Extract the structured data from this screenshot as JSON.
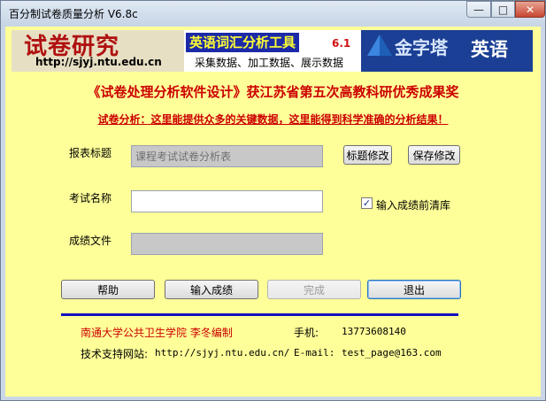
{
  "window": {
    "title": "百分制试卷质量分析 V6.8c",
    "min_glyph": "—",
    "max_glyph": "□",
    "close_glyph": "✕"
  },
  "banner": {
    "logo_title": "试卷研究",
    "logo_url": "http://sjyj.ntu.edu.cn",
    "tool_name": "英语词汇分析工具",
    "tool_version": "6.1",
    "tool_subtitle": "采集数据、加工数据、展示数据",
    "brand_jzt": "金字塔",
    "brand_english": "英语"
  },
  "award": "《试卷处理分析软件设计》获江苏省第五次高教科研优秀成果奖",
  "slogan": "试卷分析：这里能提供众多的关键数据，这里能得到科学准确的分析结果！",
  "form": {
    "report_title_label": "报表标题",
    "report_title_value": "课程考试试卷分析表",
    "btn_edit_title": "标题修改",
    "btn_save_changes": "保存修改",
    "exam_name_label": "考试名称",
    "exam_name_value": "",
    "clear_before_input_label": "输入成绩前清库",
    "clear_before_input_checked": true,
    "scores_file_label": "成绩文件",
    "scores_file_value": ""
  },
  "actions": {
    "help": "帮助",
    "input_scores": "输入成绩",
    "done": "完成",
    "exit": "退出"
  },
  "footer": {
    "author": "南通大学公共卫生学院  李冬编制",
    "phone_label": "手机:",
    "phone_value": "13773608140",
    "site_label": "技术支持网站:",
    "site_url": "http://sjyj.ntu.edu.cn/",
    "email_label": "E-mail:",
    "email_value": "test_page@163.com"
  },
  "colors": {
    "client_bg": "#ffff99",
    "accent_red": "#cc0000",
    "divider_blue": "#1010c0",
    "banner_blue": "#1c2aa8"
  }
}
